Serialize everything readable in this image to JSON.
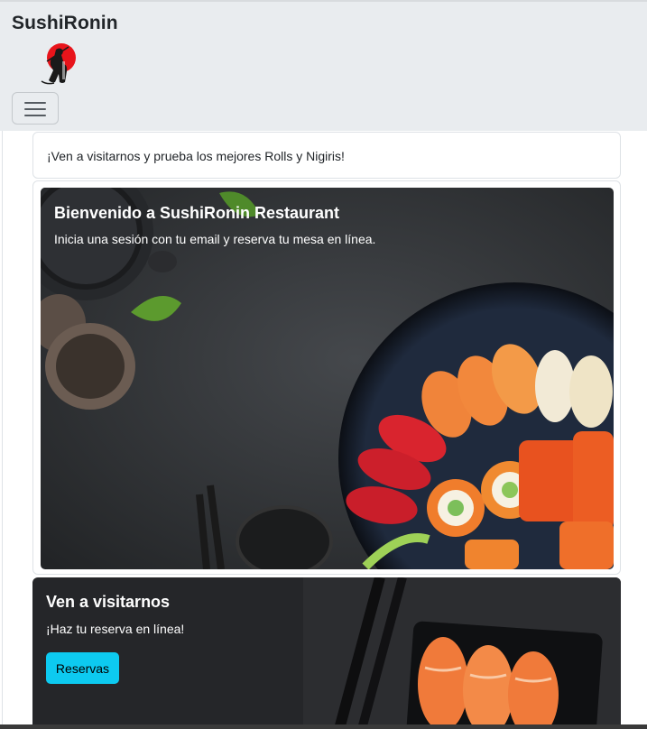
{
  "navbar": {
    "brand": "SushiRonin",
    "logo_icon": "samurai-sun-logo",
    "toggler_icon": "hamburger-menu-icon"
  },
  "promo": {
    "text": "¡Ven a visitarnos y prueba los mejores Rolls y Nigiris!"
  },
  "hero": {
    "title": "Bienvenido a SushiRonin Restaurant",
    "text": "Inicia una sesión con tu email y reserva tu mesa en línea."
  },
  "visit": {
    "title": "Ven a visitarnos",
    "text": "¡Haz tu reserva en línea!",
    "button_label": "Reservas"
  },
  "colors": {
    "navbar_bg": "#e9ecef",
    "accent_button": "#0dcaf0",
    "logo_sun": "#e8141b"
  }
}
